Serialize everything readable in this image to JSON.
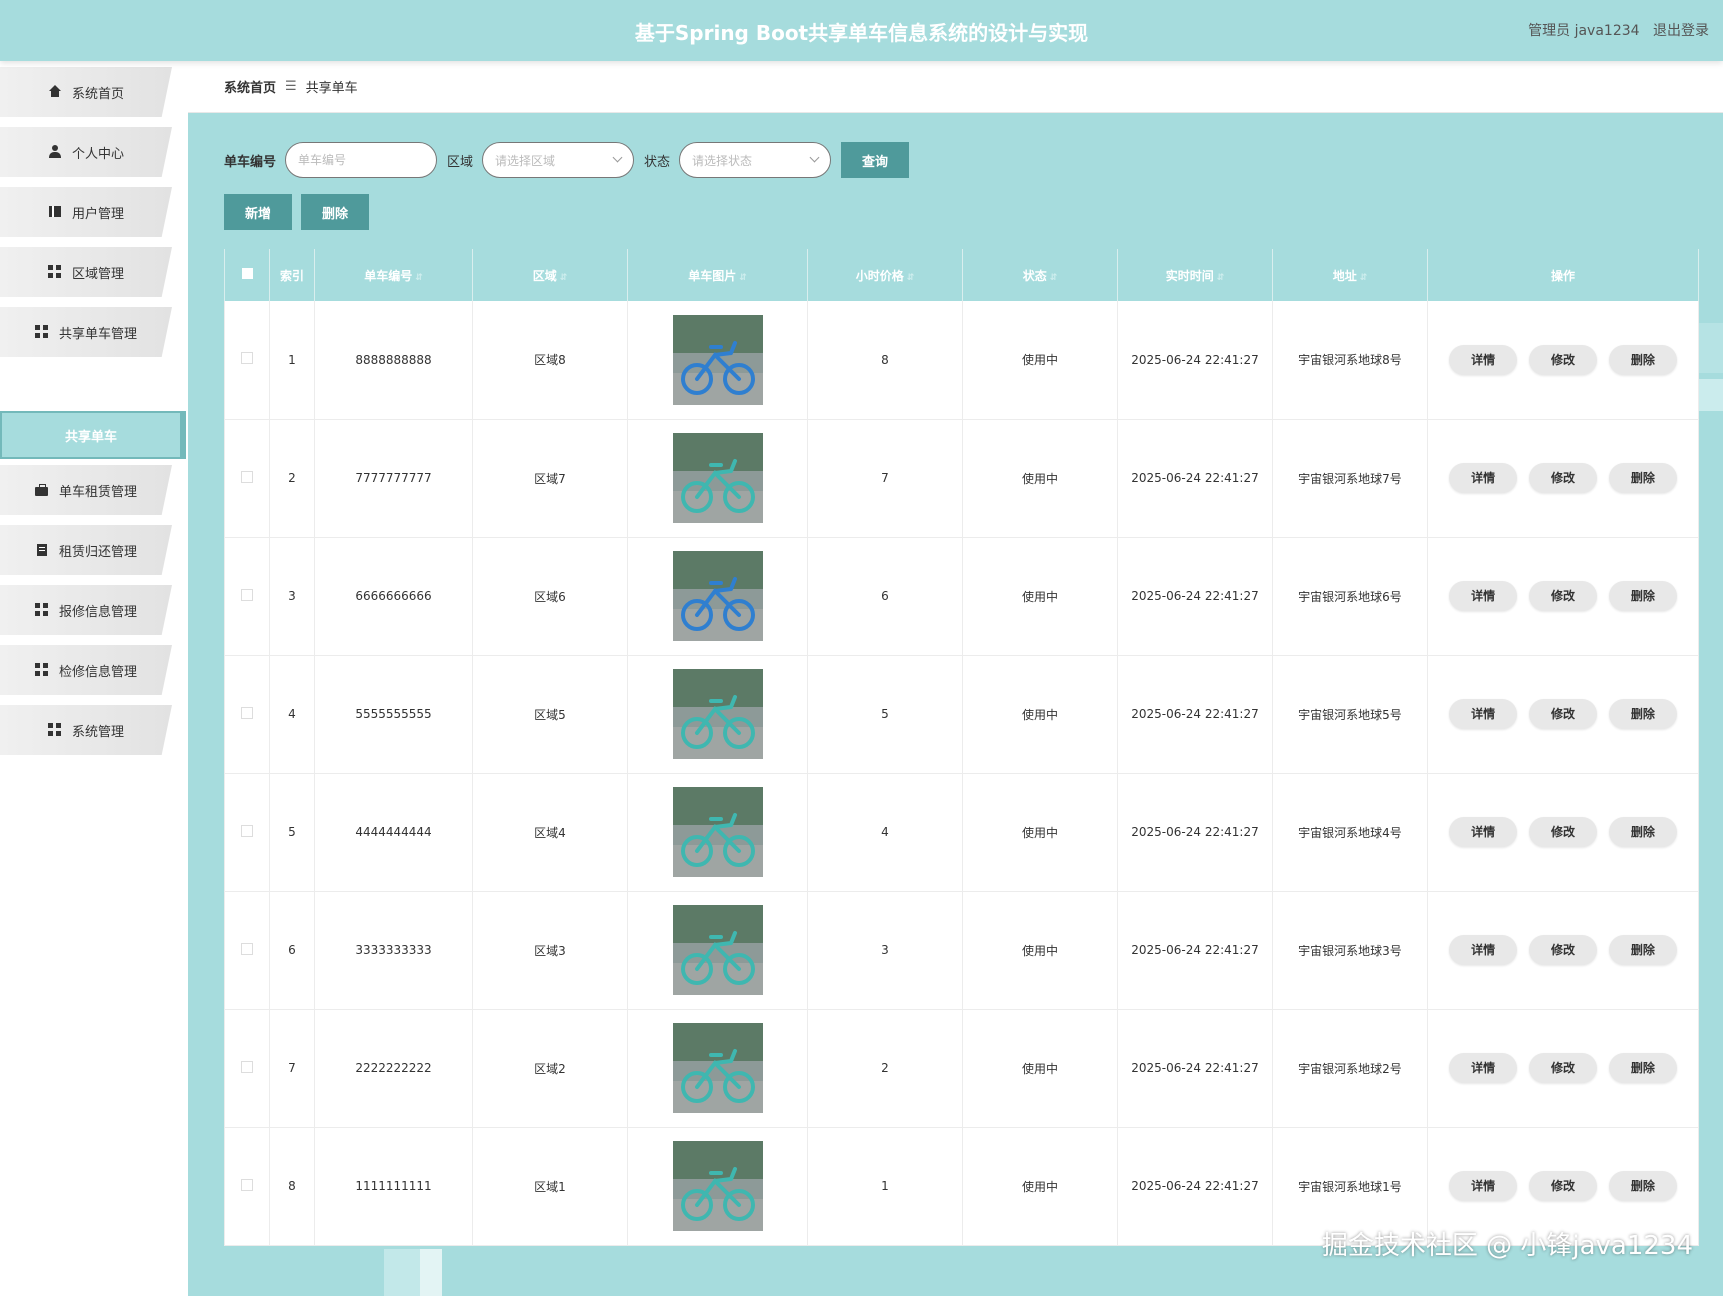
{
  "header": {
    "title": "基于Spring Boot共享单车信息系统的设计与实现",
    "user_label": "管理员 java1234",
    "logout_label": "退出登录"
  },
  "sidebar": {
    "items": [
      {
        "label": "系统首页",
        "icon": "home-icon"
      },
      {
        "label": "个人中心",
        "icon": "user-icon"
      },
      {
        "label": "用户管理",
        "icon": "book-icon"
      },
      {
        "label": "区域管理",
        "icon": "grid-icon"
      },
      {
        "label": "共享单车管理",
        "icon": "grid-icon"
      },
      {
        "label": "单车租赁管理",
        "icon": "briefcase-icon"
      },
      {
        "label": "租赁归还管理",
        "icon": "clipboard-icon"
      },
      {
        "label": "报修信息管理",
        "icon": "grid-icon"
      },
      {
        "label": "检修信息管理",
        "icon": "grid-icon"
      },
      {
        "label": "系统管理",
        "icon": "grid-icon"
      }
    ],
    "active_sub": "共享单车"
  },
  "breadcrumb": {
    "home": "系统首页",
    "separator": "☰",
    "current": "共享单车"
  },
  "search": {
    "code_label": "单车编号",
    "code_placeholder": "单车编号",
    "area_label": "区域",
    "area_placeholder": "请选择区域",
    "status_label": "状态",
    "status_placeholder": "请选择状态",
    "query_label": "查询"
  },
  "actions": {
    "add_label": "新增",
    "delete_label": "删除"
  },
  "table": {
    "headers": [
      "索引",
      "单车编号",
      "区域",
      "单车图片",
      "小时价格",
      "状态",
      "实时时间",
      "地址",
      "操作"
    ],
    "rows": [
      {
        "index": "1",
        "code": "8888888888",
        "area": "区域8",
        "price": "8",
        "status": "使用中",
        "time": "2025-06-24 22:41:27",
        "address": "宇宙银河系地球8号"
      },
      {
        "index": "2",
        "code": "7777777777",
        "area": "区域7",
        "price": "7",
        "status": "使用中",
        "time": "2025-06-24 22:41:27",
        "address": "宇宙银河系地球7号"
      },
      {
        "index": "3",
        "code": "6666666666",
        "area": "区域6",
        "price": "6",
        "status": "使用中",
        "time": "2025-06-24 22:41:27",
        "address": "宇宙银河系地球6号"
      },
      {
        "index": "4",
        "code": "5555555555",
        "area": "区域5",
        "price": "5",
        "status": "使用中",
        "time": "2025-06-24 22:41:27",
        "address": "宇宙银河系地球5号"
      },
      {
        "index": "5",
        "code": "4444444444",
        "area": "区域4",
        "price": "4",
        "status": "使用中",
        "time": "2025-06-24 22:41:27",
        "address": "宇宙银河系地球4号"
      },
      {
        "index": "6",
        "code": "3333333333",
        "area": "区域3",
        "price": "3",
        "status": "使用中",
        "time": "2025-06-24 22:41:27",
        "address": "宇宙银河系地球3号"
      },
      {
        "index": "7",
        "code": "2222222222",
        "area": "区域2",
        "price": "2",
        "status": "使用中",
        "time": "2025-06-24 22:41:27",
        "address": "宇宙银河系地球2号"
      },
      {
        "index": "8",
        "code": "1111111111",
        "area": "区域1",
        "price": "1",
        "status": "使用中",
        "time": "2025-06-24 22:41:27",
        "address": "宇宙银河系地球1号"
      }
    ],
    "op_labels": {
      "detail": "详情",
      "edit": "修改",
      "delete": "删除"
    }
  },
  "watermark": "掘金技术社区 @ 小锋java1234",
  "colors": {
    "accent": "#a6dcdd",
    "button": "#4f9a9b",
    "bike_teal": "#3fb7b0",
    "bike_blue": "#2f7fd0"
  }
}
